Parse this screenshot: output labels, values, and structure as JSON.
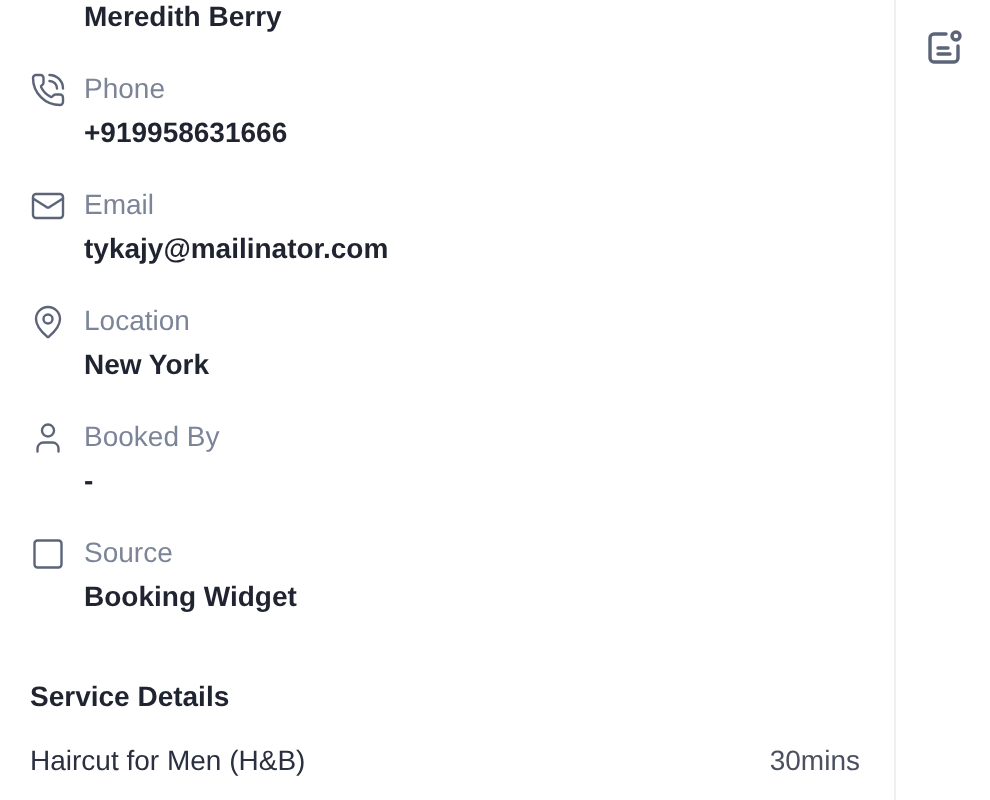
{
  "customer_name": "Meredith Berry",
  "fields": [
    {
      "kind": "phone",
      "label": "Phone",
      "value": "+919958631666"
    },
    {
      "kind": "email",
      "label": "Email",
      "value": "tykajy@mailinator.com"
    },
    {
      "kind": "location",
      "label": "Location",
      "value": "New York"
    },
    {
      "kind": "person",
      "label": "Booked By",
      "value": "-"
    },
    {
      "kind": "source",
      "label": "Source",
      "value": "Booking Widget"
    }
  ],
  "service_details": {
    "title": "Service Details",
    "items": [
      {
        "name": "Haircut for Men (H&B)",
        "duration": "30mins"
      }
    ]
  }
}
